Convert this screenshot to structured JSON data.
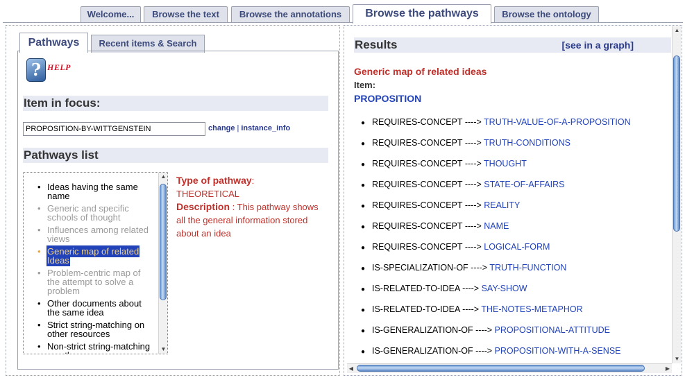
{
  "top_tabs": [
    {
      "label": "Welcome...",
      "active": false
    },
    {
      "label": "Browse the text",
      "active": false
    },
    {
      "label": "Browse the annotations",
      "active": false
    },
    {
      "label": "Browse the pathways",
      "active": true
    },
    {
      "label": "Browse the ontology",
      "active": false
    }
  ],
  "left": {
    "tabs": [
      {
        "label": "Pathways",
        "active": true
      },
      {
        "label": "Recent items & Search",
        "active": false
      }
    ],
    "help_label": "HELP",
    "help_glyph": "?",
    "item_in_focus_heading": "Item in focus:",
    "focus_value": "PROPOSITION-BY-WITTGENSTEIN",
    "change_link": "change",
    "link_separator": "|",
    "instance_info_link": "instance_info",
    "pathways_list_heading": "Pathways list",
    "pathways": [
      {
        "label": "Ideas having the same name",
        "state": "on"
      },
      {
        "label": "Generic and specific schools of thought",
        "state": "off"
      },
      {
        "label": "Influences among related views",
        "state": "off"
      },
      {
        "label": "Generic map of related Ideas",
        "state": "selected"
      },
      {
        "label": "Problem-centric map of the attempt to solve a problem",
        "state": "off"
      },
      {
        "label": "Other documents about the same idea",
        "state": "on"
      },
      {
        "label": "Strict string-matching on other resources",
        "state": "on"
      },
      {
        "label": "Non-strict string-matching on other resources",
        "state": "on"
      }
    ],
    "type_label": "Type of pathway",
    "type_value": "THEORETICAL",
    "description_label": "Description",
    "description_value": "This pathway shows all the general information stored about an idea"
  },
  "right": {
    "results_title": "Results",
    "see_graph_link": "[see in a graph]",
    "map_title": "Generic map of related ideas",
    "item_label": "Item:",
    "item_value": "PROPOSITION",
    "arrow": "---->",
    "relations": [
      {
        "relation": "REQUIRES-CONCEPT",
        "target": "TRUTH-VALUE-OF-A-PROPOSITION"
      },
      {
        "relation": "REQUIRES-CONCEPT",
        "target": "TRUTH-CONDITIONS"
      },
      {
        "relation": "REQUIRES-CONCEPT",
        "target": "THOUGHT"
      },
      {
        "relation": "REQUIRES-CONCEPT",
        "target": "STATE-OF-AFFAIRS"
      },
      {
        "relation": "REQUIRES-CONCEPT",
        "target": "REALITY"
      },
      {
        "relation": "REQUIRES-CONCEPT",
        "target": "NAME"
      },
      {
        "relation": "REQUIRES-CONCEPT",
        "target": "LOGICAL-FORM"
      },
      {
        "relation": "IS-SPECIALIZATION-OF",
        "target": "TRUTH-FUNCTION"
      },
      {
        "relation": "IS-RELATED-TO-IDEA",
        "target": "SAY-SHOW"
      },
      {
        "relation": "IS-RELATED-TO-IDEA",
        "target": "THE-NOTES-METAPHOR"
      },
      {
        "relation": "IS-GENERALIZATION-OF",
        "target": "PROPOSITIONAL-ATTITUDE"
      },
      {
        "relation": "IS-GENERALIZATION-OF",
        "target": "PROPOSITION-WITH-A-SENSE"
      }
    ]
  },
  "colors": {
    "heading_red": "#c0302a",
    "link_blue": "#2142b9",
    "tab_text": "#3c4a7c",
    "section_bg": "#e7e9f3"
  }
}
